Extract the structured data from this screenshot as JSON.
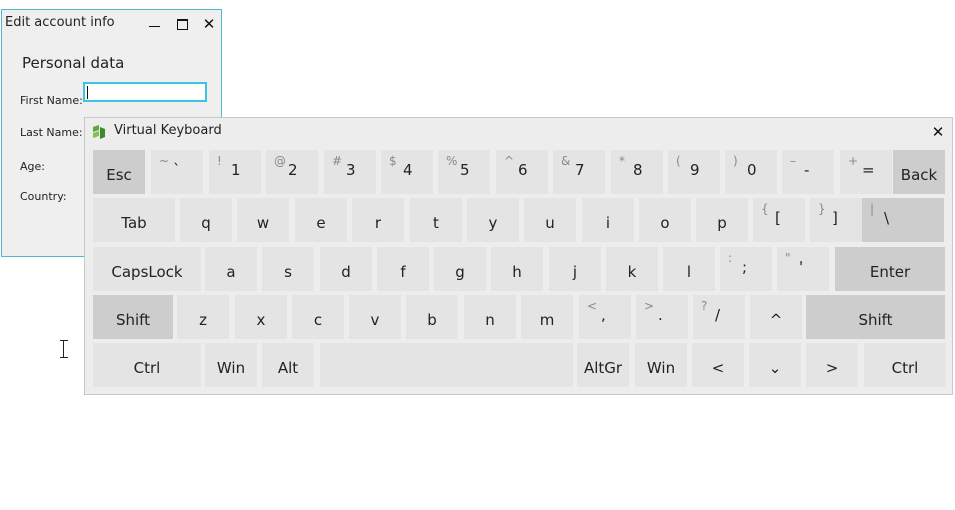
{
  "edit_window": {
    "title": "Edit account info",
    "section_title": "Personal data",
    "fields": [
      {
        "label": "First Name:",
        "value": ""
      },
      {
        "label": "Last Name:"
      },
      {
        "label": "Age:"
      },
      {
        "label": "Country:"
      }
    ],
    "accent": "#3cc4e4"
  },
  "keyboard": {
    "title": "Virtual Keyboard",
    "logo_icon": "virtual-keyboard-logo-icon",
    "close_icon": "close-icon",
    "rows": [
      [
        {
          "main": "Esc"
        },
        {
          "main": "`",
          "shifted": "~"
        },
        {
          "main": "1",
          "shifted": "!"
        },
        {
          "main": "2",
          "shifted": "@"
        },
        {
          "main": "3",
          "shifted": "#"
        },
        {
          "main": "4",
          "shifted": "$"
        },
        {
          "main": "5",
          "shifted": "%"
        },
        {
          "main": "6",
          "shifted": "^"
        },
        {
          "main": "7",
          "shifted": "&"
        },
        {
          "main": "8",
          "shifted": "*"
        },
        {
          "main": "9",
          "shifted": "("
        },
        {
          "main": "0",
          "shifted": ")"
        },
        {
          "main": "-",
          "shifted": "–"
        },
        {
          "main": "=",
          "shifted": "+"
        },
        {
          "main": "Back"
        }
      ],
      [
        {
          "main": "Tab"
        },
        {
          "main": "q"
        },
        {
          "main": "w"
        },
        {
          "main": "e"
        },
        {
          "main": "r"
        },
        {
          "main": "t"
        },
        {
          "main": "y"
        },
        {
          "main": "u"
        },
        {
          "main": "i"
        },
        {
          "main": "o"
        },
        {
          "main": "p"
        },
        {
          "main": "[",
          "shifted": "{"
        },
        {
          "main": "]",
          "shifted": "}"
        },
        {
          "main": "\\",
          "shifted": "|"
        }
      ],
      [
        {
          "main": "CapsLock"
        },
        {
          "main": "a"
        },
        {
          "main": "s"
        },
        {
          "main": "d"
        },
        {
          "main": "f"
        },
        {
          "main": "g"
        },
        {
          "main": "h"
        },
        {
          "main": "j"
        },
        {
          "main": "k"
        },
        {
          "main": "l"
        },
        {
          "main": ";",
          "shifted": ":"
        },
        {
          "main": "'",
          "shifted": "\""
        },
        {
          "main": "Enter"
        }
      ],
      [
        {
          "main": "Shift"
        },
        {
          "main": "z"
        },
        {
          "main": "x"
        },
        {
          "main": "c"
        },
        {
          "main": "v"
        },
        {
          "main": "b"
        },
        {
          "main": "n"
        },
        {
          "main": "m"
        },
        {
          "main": ",",
          "shifted": "<"
        },
        {
          "main": ".",
          "shifted": ">"
        },
        {
          "main": "/",
          "shifted": "?"
        },
        {
          "main": "^"
        },
        {
          "main": "Shift"
        }
      ],
      [
        {
          "main": "Ctrl"
        },
        {
          "main": "Win"
        },
        {
          "main": "Alt"
        },
        {
          "main": ""
        },
        {
          "main": "AltGr"
        },
        {
          "main": "Win"
        },
        {
          "main": "<"
        },
        {
          "main": "⌄"
        },
        {
          "main": ">"
        },
        {
          "main": "Ctrl"
        }
      ]
    ]
  }
}
